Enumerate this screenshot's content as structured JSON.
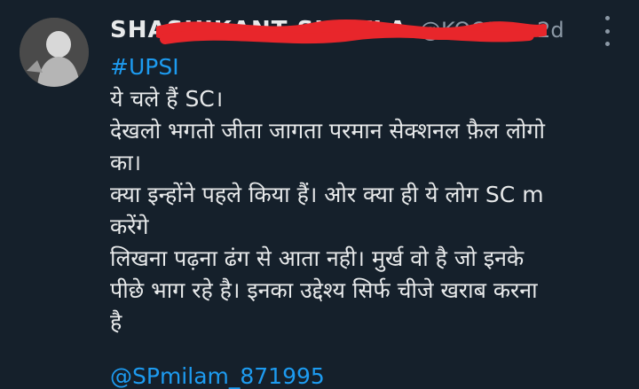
{
  "tweet": {
    "display_name": "SHASHIKANT SHUKLA",
    "handle": "@KOOL...",
    "separator": "·",
    "timestamp": "2d",
    "hashtag": "#UPSI",
    "lines": [
      "ये चले हैं SC।",
      "देखलो भगतो जीता जागता परमान सेक्शनल फ़ैल लोगो",
      "का।",
      "क्या इन्होंने पहले किया हैं। ओर क्या ही ये लोग SC m",
      "करेंगे",
      "लिखना पढ़ना ढंग से आता नही। मुर्ख वो है जो इनके",
      "पीछे भाग रहे है। इनका उद्देश्य सिर्फ चीजे खराब करना",
      "है"
    ],
    "mention": "@SPmilam_871995"
  },
  "colors": {
    "background": "#15202b",
    "text": "#e7e9ea",
    "muted": "#8b98a5",
    "link": "#1d9bf0",
    "redaction": "#e8262b"
  },
  "icons": {
    "more": "more-vertical-icon"
  }
}
